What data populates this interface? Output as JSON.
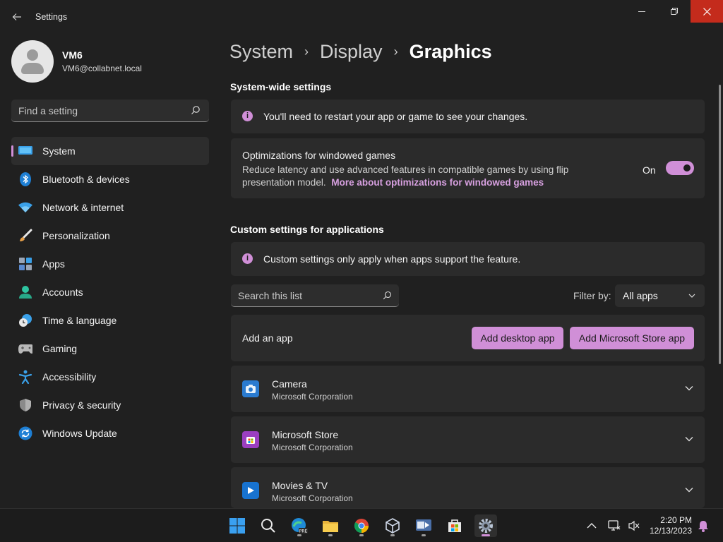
{
  "window": {
    "app_title": "Settings",
    "controls": [
      "minimize-icon",
      "restore-icon",
      "close-icon"
    ],
    "close_color": "#c42b1c"
  },
  "user": {
    "name": "VM6",
    "email": "VM6@collabnet.local"
  },
  "sidebar": {
    "search_placeholder": "Find a setting",
    "items": [
      {
        "label": "System",
        "icon": "system-display-icon",
        "active": true
      },
      {
        "label": "Bluetooth & devices",
        "icon": "bluetooth-icon"
      },
      {
        "label": "Network & internet",
        "icon": "wifi-icon"
      },
      {
        "label": "Personalization",
        "icon": "paintbrush-icon"
      },
      {
        "label": "Apps",
        "icon": "apps-icon"
      },
      {
        "label": "Accounts",
        "icon": "person-icon"
      },
      {
        "label": "Time & language",
        "icon": "clock-globe-icon"
      },
      {
        "label": "Gaming",
        "icon": "controller-icon"
      },
      {
        "label": "Accessibility",
        "icon": "accessibility-icon"
      },
      {
        "label": "Privacy & security",
        "icon": "shield-icon"
      },
      {
        "label": "Windows Update",
        "icon": "update-icon"
      }
    ]
  },
  "breadcrumb": {
    "items": [
      "System",
      "Display",
      "Graphics"
    ]
  },
  "system_wide": {
    "title": "System-wide settings",
    "info": "You'll need to restart your app or game to see your changes.",
    "optimization": {
      "title": "Optimizations for windowed games",
      "description": "Reduce latency and use advanced features in compatible games by using flip presentation model.",
      "link": "More about optimizations for windowed games",
      "toggle_label": "On",
      "toggle_on": true
    }
  },
  "custom": {
    "title": "Custom settings for applications",
    "info": "Custom settings only apply when apps support the feature.",
    "search_placeholder": "Search this list",
    "filter_label": "Filter by:",
    "filter_value": "All apps",
    "add_label": "Add an app",
    "add_desktop": "Add desktop app",
    "add_store": "Add Microsoft Store app",
    "apps": [
      {
        "name": "Camera",
        "publisher": "Microsoft Corporation",
        "icon": "camera-icon"
      },
      {
        "name": "Microsoft Store",
        "publisher": "Microsoft Corporation",
        "icon": "store-icon"
      },
      {
        "name": "Movies & TV",
        "publisher": "Microsoft Corporation",
        "icon": "movies-icon"
      }
    ]
  },
  "taskbar": {
    "icons": [
      "windows-start-icon",
      "search-icon",
      "edge-icon",
      "file-explorer-icon",
      "chrome-icon",
      "virtualbox-icon",
      "vscode-icon",
      "microsoft-store-icon",
      "settings-icon"
    ],
    "time": "2:20 PM",
    "date": "12/13/2023"
  },
  "colors": {
    "accent": "#d08fd7",
    "background": "#202020",
    "card": "#2b2b2b"
  }
}
